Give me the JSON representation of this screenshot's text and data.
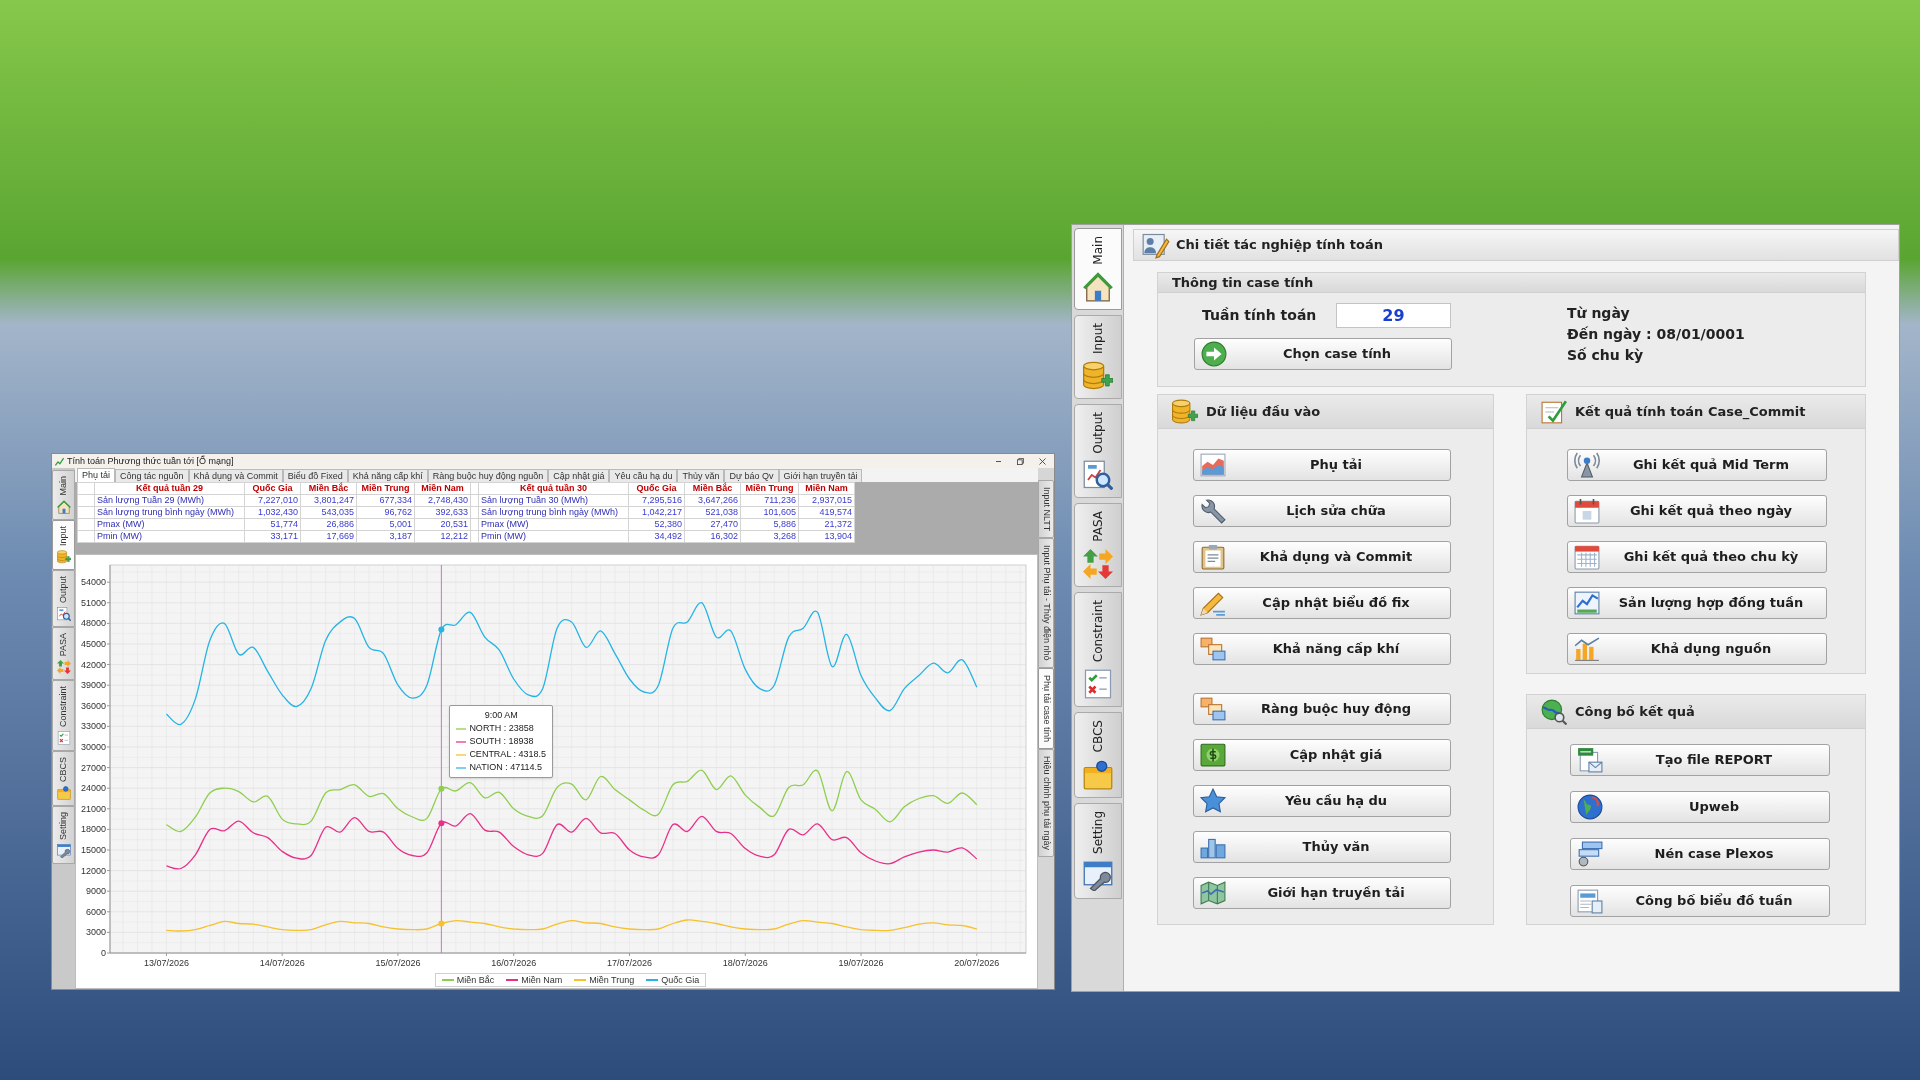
{
  "calc_window": {
    "title": "Tính toán Phương thức tuần tới [Ổ mạng]",
    "side_tabs": [
      {
        "label": "Main",
        "selected": false
      },
      {
        "label": "Input",
        "selected": true
      },
      {
        "label": "Output",
        "selected": false
      },
      {
        "label": "PASA",
        "selected": false
      },
      {
        "label": "Constraint",
        "selected": false
      },
      {
        "label": "CBCS",
        "selected": false
      },
      {
        "label": "Setting",
        "selected": false
      }
    ],
    "tabs": [
      {
        "label": "Phụ tải",
        "selected": true
      },
      {
        "label": "Công tác nguồn",
        "selected": false
      },
      {
        "label": "Khả dụng và Commit",
        "selected": false
      },
      {
        "label": "Biểu đồ Fixed",
        "selected": false
      },
      {
        "label": "Khả năng cấp khí",
        "selected": false
      },
      {
        "label": "Ràng buộc huy động nguồn",
        "selected": false
      },
      {
        "label": "Cập nhật giá",
        "selected": false
      },
      {
        "label": "Yêu cầu hạ du",
        "selected": false
      },
      {
        "label": "Thủy văn",
        "selected": false
      },
      {
        "label": "Dự báo Qv",
        "selected": false
      },
      {
        "label": "Giới hạn truyền tải",
        "selected": false
      }
    ],
    "table": {
      "groups": [
        {
          "columns": [
            "Kết quả tuần 29",
            "Quốc Gia",
            "Miền Bắc",
            "Miền Trung",
            "Miền Nam"
          ],
          "rows": [
            [
              "Sản lượng Tuần 29 (MWh)",
              "7,227,010",
              "3,801,247",
              "677,334",
              "2,748,430"
            ],
            [
              "Sản lượng trung bình ngày (MWh)",
              "1,032,430",
              "543,035",
              "96,762",
              "392,633"
            ],
            [
              "Pmax (MW)",
              "51,774",
              "26,886",
              "5,001",
              "20,531"
            ],
            [
              "Pmin (MW)",
              "33,171",
              "17,669",
              "3,187",
              "12,212"
            ]
          ]
        },
        {
          "columns": [
            "Kết quả tuần 30",
            "Quốc Gia",
            "Miền Bắc",
            "Miền Trung",
            "Miền Nam"
          ],
          "rows": [
            [
              "Sản lượng Tuần 30 (MWh)",
              "7,295,516",
              "3,647,266",
              "711,236",
              "2,937,015"
            ],
            [
              "Sản lượng trung bình ngày (MWh)",
              "1,042,217",
              "521,038",
              "101,605",
              "419,574"
            ],
            [
              "Pmax (MW)",
              "52,380",
              "27,470",
              "5,886",
              "21,372"
            ],
            [
              "Pmin (MW)",
              "34,492",
              "16,302",
              "3,268",
              "13,904"
            ]
          ]
        }
      ]
    },
    "chart": {
      "chart_data": {
        "type": "line",
        "categories": [
          "13/07/2026",
          null,
          null,
          null,
          null,
          null,
          null,
          null,
          "14/07/2026",
          null,
          null,
          null,
          null,
          null,
          null,
          null,
          "15/07/2026",
          null,
          null,
          null,
          null,
          null,
          null,
          null,
          "16/07/2026",
          null,
          null,
          null,
          null,
          null,
          null,
          null,
          "17/07/2026",
          null,
          null,
          null,
          null,
          null,
          null,
          null,
          "18/07/2026",
          null,
          null,
          null,
          null,
          null,
          null,
          null,
          "19/07/2026",
          null,
          null,
          null,
          null,
          null,
          null,
          null,
          "20/07/2026"
        ],
        "series": [
          {
            "name": "Miền Bắc",
            "color": "#8fce4e",
            "values": [
              18700,
              17700,
              19800,
              23300,
              24000,
              23500,
              22000,
              22800,
              19500,
              18800,
              19200,
              23300,
              23800,
              24500,
              22800,
              23200,
              21000,
              19800,
              19600,
              23900,
              23600,
              24800,
              22600,
              23400,
              21000,
              19900,
              20000,
              24100,
              24600,
              22300,
              25700,
              23800,
              22300,
              20800,
              20200,
              24500,
              25000,
              26600,
              23800,
              25800,
              23000,
              21200,
              20000,
              24100,
              24500,
              26500,
              20700,
              26400,
              22300,
              20900,
              19100,
              21300,
              22500,
              22900,
              21800,
              23300,
              21600
            ]
          },
          {
            "name": "Miền Nam",
            "color": "#e8308a",
            "values": [
              12700,
              12300,
              14300,
              18000,
              17800,
              19200,
              17500,
              16800,
              14800,
              13800,
              14200,
              18300,
              17600,
              19700,
              17700,
              17600,
              15200,
              14200,
              14600,
              18900,
              18500,
              20300,
              17900,
              17600,
              15500,
              14300,
              14500,
              18700,
              17600,
              19600,
              17500,
              17400,
              15000,
              14000,
              14300,
              18700,
              17700,
              19900,
              17700,
              17400,
              15200,
              14100,
              14300,
              18000,
              17200,
              18800,
              16500,
              16800,
              14600,
              13400,
              13000,
              14000,
              14700,
              15000,
              14700,
              15300,
              13700
            ]
          },
          {
            "name": "Miền Trung",
            "color": "#f5c12e",
            "values": [
              3300,
              3200,
              3400,
              4000,
              4600,
              4300,
              4200,
              3800,
              3400,
              3300,
              3400,
              4100,
              4600,
              4400,
              4300,
              3800,
              3500,
              3400,
              3500,
              4300,
              4700,
              4500,
              4300,
              3800,
              3500,
              3400,
              3500,
              4200,
              4700,
              4400,
              4300,
              3800,
              3500,
              3400,
              3500,
              4300,
              4800,
              4600,
              4300,
              3800,
              3500,
              3400,
              3500,
              4200,
              4700,
              4500,
              4300,
              3800,
              3400,
              3300,
              3300,
              3700,
              4200,
              4400,
              4100,
              4000,
              3500
            ]
          },
          {
            "name": "Quốc Gia",
            "color": "#26b4e4",
            "values": [
              34800,
              33300,
              37000,
              45500,
              48000,
              43500,
              44500,
              41000,
              37600,
              35900,
              38500,
              45500,
              48200,
              48700,
              44500,
              43600,
              39000,
              37100,
              39000,
              47100,
              47800,
              49600,
              46000,
              44100,
              39900,
              37600,
              38500,
              47300,
              48200,
              44500,
              46900,
              43600,
              39900,
              38000,
              39000,
              47300,
              48200,
              51000,
              46000,
              46900,
              41300,
              38500,
              39000,
              46000,
              47300,
              49600,
              41700,
              46400,
              40400,
              37100,
              35300,
              38500,
              40400,
              42200,
              40800,
              42700,
              38700
            ]
          }
        ],
        "ylim": [
          0,
          56500
        ],
        "yticks": [
          0,
          3000,
          6000,
          9000,
          12000,
          15000,
          18000,
          21000,
          24000,
          27000,
          30000,
          33000,
          36000,
          39000,
          42000,
          45000,
          48000,
          51000,
          54000
        ],
        "grid": true,
        "legend": "bottom"
      },
      "tooltip": {
        "title": "9:00 AM",
        "items": [
          {
            "label": "NORTH : 23858",
            "color": "#b4e08a"
          },
          {
            "label": "SOUTH : 18938",
            "color": "#f27cb4"
          },
          {
            "label": "CENTRAL : 4318.5",
            "color": "#f9d77a"
          },
          {
            "label": "NATION : 47114.5",
            "color": "#7fd0ef"
          }
        ]
      }
    },
    "right_tabs": [
      {
        "label": "Input NLTT",
        "selected": false
      },
      {
        "label": "Input Phụ tải - Thủy điện nhỏ",
        "selected": false
      },
      {
        "label": "Phụ tải case tính",
        "selected": true
      },
      {
        "label": "Hiệu chỉnh phụ tải ngày",
        "selected": false
      }
    ]
  },
  "main_window": {
    "side_tabs": [
      {
        "label": "Main",
        "selected": true
      },
      {
        "label": "Input",
        "selected": false
      },
      {
        "label": "Output",
        "selected": false
      },
      {
        "label": "PASA",
        "selected": false
      },
      {
        "label": "Constraint",
        "selected": false
      },
      {
        "label": "CBCS",
        "selected": false
      },
      {
        "label": "Setting",
        "selected": false
      }
    ],
    "header": {
      "title": "Chi tiết tác nghiệp tính toán"
    },
    "case_info": {
      "title": "Thông tin case tính",
      "week_label": "Tuần tính toán",
      "week_value": "29",
      "choose_button": "Chọn case tính",
      "details": [
        "Từ ngày",
        "Đến ngày : 08/01/0001",
        "Số chu kỳ"
      ]
    },
    "input_data": {
      "title": "Dữ liệu đầu vào",
      "button_groups": [
        [
          "Phụ tải",
          "Lịch sửa chữa",
          "Khả dụng và Commit",
          "Cập nhật biểu đồ fix",
          "Khả năng cấp khí"
        ],
        [
          "Ràng buộc huy động",
          "Cập nhật giá",
          "Yêu cầu hạ du",
          "Thủy văn",
          "Giới hạn truyền tải"
        ]
      ]
    },
    "results": {
      "title": "Kết quả tính toán Case_Commit",
      "buttons": [
        "Ghi kết quả Mid Term",
        "Ghi kết quả theo ngày",
        "Ghi kết quả theo chu kỳ",
        "Sản lượng hợp đồng tuần",
        "Khả dụng nguồn"
      ]
    },
    "publish": {
      "title": "Công bố kết quả",
      "buttons": [
        "Tạo file REPORT",
        "Upweb",
        "Nén case Plexos",
        "Công bố biểu đồ tuần"
      ]
    }
  }
}
